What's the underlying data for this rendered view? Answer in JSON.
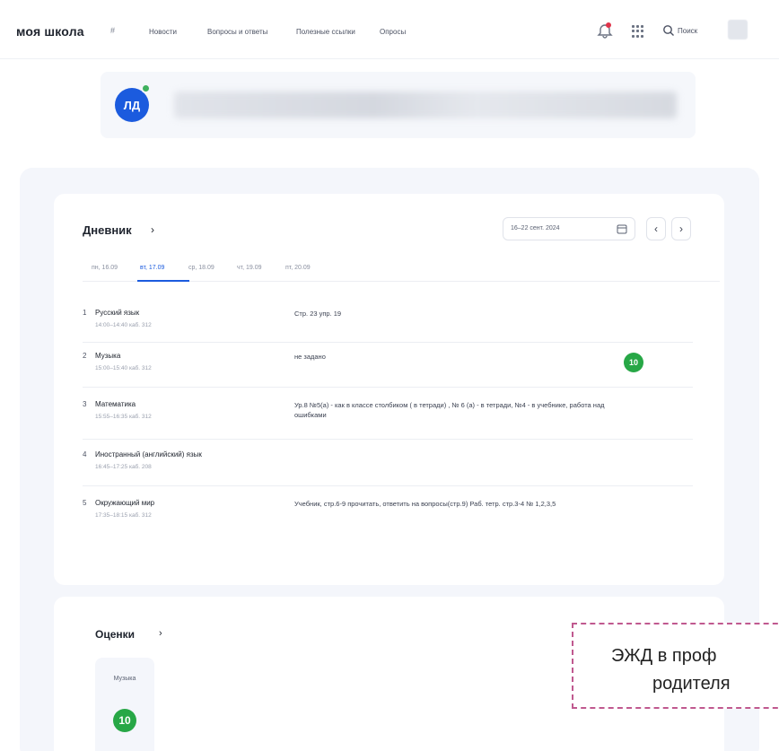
{
  "header": {
    "logo": "моя школа",
    "logo_mark": "#",
    "nav": [
      "Новости",
      "Вопросы и ответы",
      "Полезные ссылки",
      "Опросы"
    ],
    "search_label": "Поиск",
    "icons": [
      "bell-icon",
      "apps-grid-icon",
      "search-icon"
    ]
  },
  "profile": {
    "initials": "ЛД",
    "status_color": "#3fb15e"
  },
  "diary": {
    "title": "Дневник",
    "arrow": "›",
    "date_range": "16–22 сент. 2024",
    "prev": "‹",
    "next": "›",
    "tabs": [
      "пн, 16.09",
      "вт, 17.09",
      "ср, 18.09",
      "чт, 19.09",
      "пт, 20.09"
    ],
    "active_tab": 1,
    "lessons": [
      {
        "num": "1",
        "name": "Русский язык",
        "time": "14:00–14:40 каб. 312",
        "homework": "Стр. 23 упр. 19",
        "grade": ""
      },
      {
        "num": "2",
        "name": "Музыка",
        "time": "15:00–15:40 каб. 312",
        "homework": "не задано",
        "grade": "10"
      },
      {
        "num": "3",
        "name": "Математика",
        "time": "15:55–16:35 каб. 312",
        "homework": "Ур.8 №5(а) - как в классе столбиком ( в тетради) , № 6 (а) - в тетради, №4 - в учебнике, работа над ошибками",
        "grade": ""
      },
      {
        "num": "4",
        "name": "Иностранный (английский) язык",
        "time": "16:45–17:25 каб. 208",
        "homework": "",
        "grade": ""
      },
      {
        "num": "5",
        "name": "Окружающий мир",
        "time": "17:35–18:15 каб. 312",
        "homework": "Учебник, стр.6-9 прочитать, ответить на вопросы(стр.9) Раб. тетр. стр.3-4 № 1,2,3,5",
        "grade": ""
      }
    ]
  },
  "grades": {
    "title": "Оценки",
    "arrow": "›",
    "items": [
      {
        "subject": "Музыка",
        "grade": "10"
      }
    ]
  },
  "callout": {
    "line1": "ЭЖД в проф",
    "line2": "родителя"
  },
  "colors": {
    "accent": "#1b5bde",
    "grade_green": "#27a746",
    "callout_border": "#c0598f"
  }
}
